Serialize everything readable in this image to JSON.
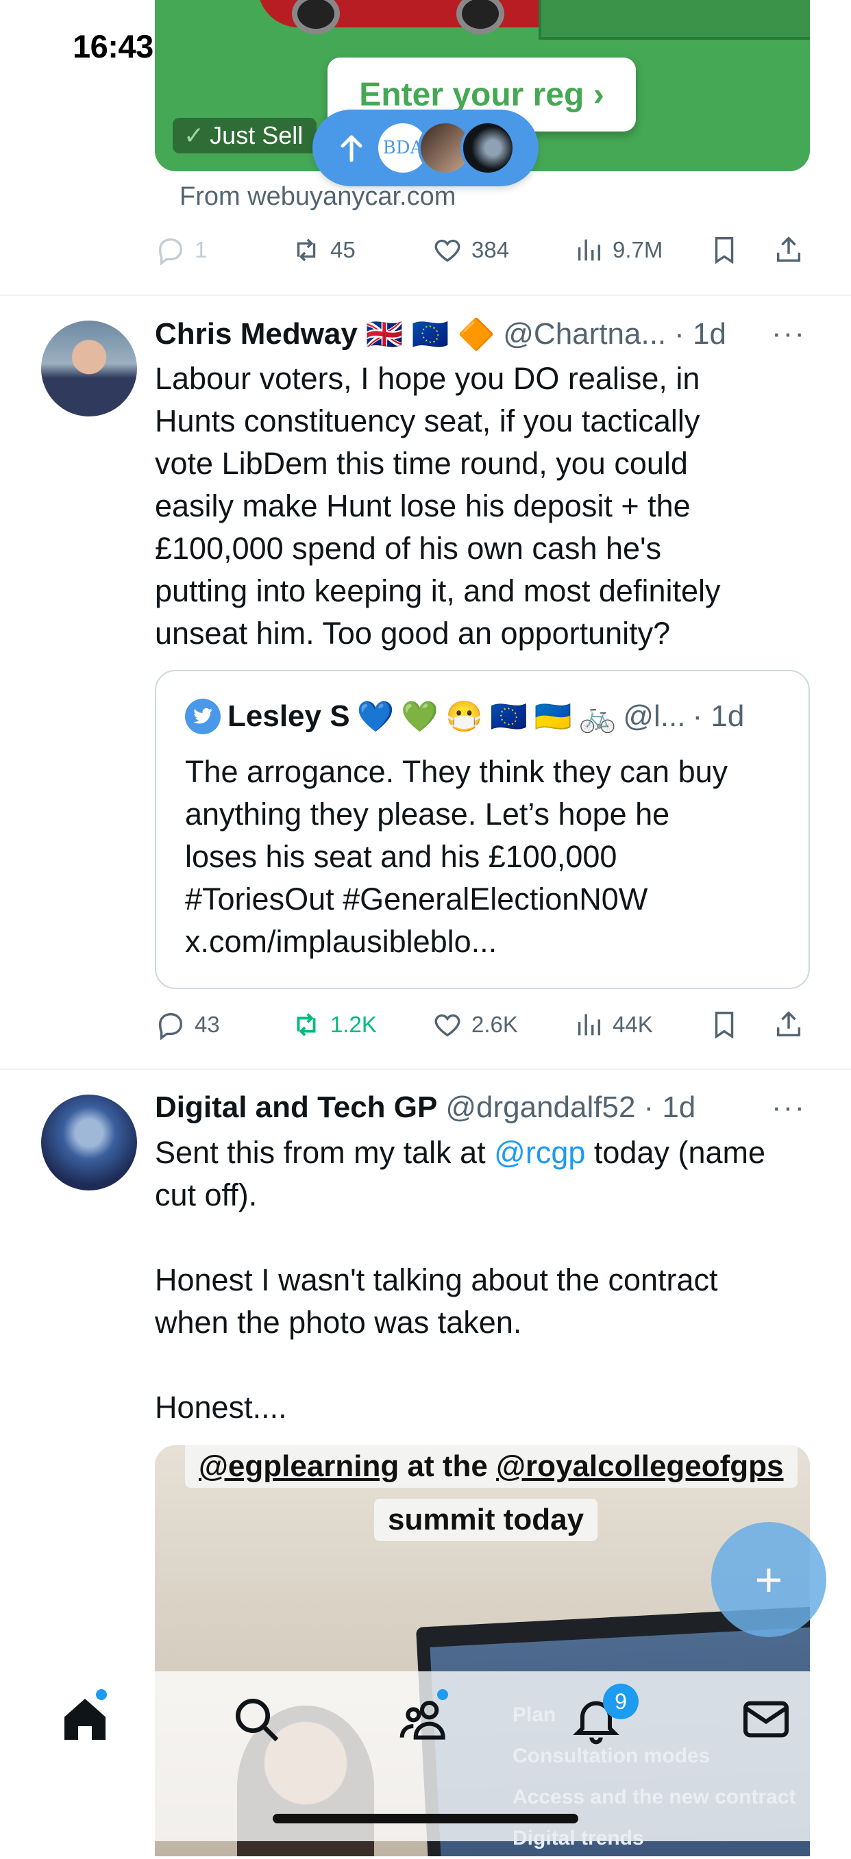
{
  "status_bar": {
    "time": "16:43"
  },
  "ad": {
    "cta": "Enter your reg ›",
    "badge": "Just Sell",
    "source": "From webuyanycar.com",
    "actions": {
      "replies": "1",
      "reposts": "45",
      "likes": "384",
      "views": "9.7M"
    },
    "colors": {
      "background": "#45a854",
      "cta_text": "#45a854"
    }
  },
  "new_posts_pill": {
    "icon": "arrow-up-icon",
    "avatar1_text": "BDA"
  },
  "posts": [
    {
      "name": "Chris Medway",
      "name_flags": [
        "🇬🇧",
        "🇪🇺",
        "🔶"
      ],
      "handle": "@Chartna...",
      "time": "· 1d",
      "more": "···",
      "text": "Labour voters, I hope you DO realise, in\nHunts constituency seat, if you tactically\nvote LibDem this time round, you could\neasily make Hunt lose his deposit + the\n£100,000 spend of his own cash he's\nputting into keeping it, and most definitely\nunseat him. Too good an opportunity?",
      "quote": {
        "name": "Lesley S",
        "emojis": [
          "💙",
          "💚",
          "😷",
          "🇪🇺",
          "🇺🇦",
          "🚲"
        ],
        "handle": "@l...",
        "time": "· 1d",
        "text": "The arrogance. They think they can buy\nanything they please. Let’s hope he\nloses his seat and his £100,000\n#ToriesOut #GeneralElectionN0W\nx.com/implausibleblo..."
      },
      "actions": {
        "replies": "43",
        "reposts": "1.2K",
        "likes": "2.6K",
        "views": "44K"
      }
    },
    {
      "name": "Digital and Tech GP",
      "handle": "@drgandalf52",
      "time": "· 1d",
      "more": "···",
      "text_before": "Sent this from my talk at ",
      "mention": "@rcgp",
      "text_after": " today (name\ncut off).\n\nHonest I wasn't talking about the contract\nwhen the photo was taken.\n\nHonest....",
      "media": {
        "caption_line1_a": "@egplearning",
        "caption_line1_b": " at the ",
        "caption_line1_c": "@royalcollegeofgps",
        "caption_line2": "summit today",
        "screen_lines": [
          "Plan",
          "Consultation modes",
          "Access and the new contract",
          "Digital trends"
        ]
      }
    }
  ],
  "tabbar": {
    "tabs": [
      "home-icon",
      "search-icon",
      "communities-icon",
      "notifications-icon",
      "messages-icon"
    ],
    "notification_count": "9"
  },
  "colors": {
    "accent": "#1d9bf0",
    "repost_active": "#00ba7c",
    "secondary_text": "#536471"
  }
}
